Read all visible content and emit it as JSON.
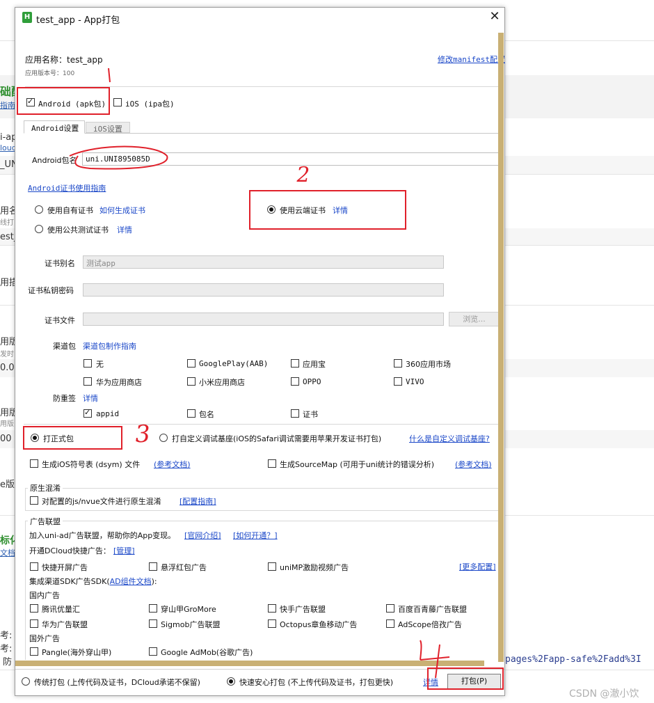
{
  "background": {
    "partial_texts": [
      "础配",
      "指南",
      "i-ap",
      "loud",
      "_UN",
      "用名",
      "线打",
      "est_",
      "用描",
      "用版",
      "发时",
      "0.0",
      "用版",
      "用版",
      "00",
      "e版",
      "标化",
      "文档",
      "考:",
      "考:",
      "防"
    ],
    "url_fragment": "pages%2Fapp-safe%2Fadd%3I"
  },
  "window": {
    "title": "test_app - App打包",
    "app_icon": "hbuilder-logo-icon",
    "close_icon": "close-icon"
  },
  "app_info": {
    "name_label": "应用名称：test_app",
    "version_label": "应用版本号：100",
    "modify_manifest_link": "修改manifest配置"
  },
  "platforms": [
    {
      "label": "Android (apk包)",
      "checked": true
    },
    {
      "label": "iOS (ipa包)",
      "checked": false
    }
  ],
  "tabs": [
    {
      "label": "Android设置",
      "active": true
    },
    {
      "label": "iOS设置",
      "active": false
    }
  ],
  "android": {
    "package_label": "Android包名",
    "package_value": "uni.UNI895085D",
    "cert_guide_link": "Android证书使用指南",
    "cert_own": "使用自有证书",
    "cert_own_link": "如何生成证书",
    "cert_public": "使用公共测试证书",
    "cert_public_link": "详情",
    "cert_cloud": "使用云端证书",
    "cert_cloud_link": "详情",
    "cert_alias_label": "证书别名",
    "cert_alias_value": "测试app",
    "cert_password_label": "证书私钥密码",
    "cert_file_label": "证书文件",
    "browse_button": "浏览...",
    "channel_label": "渠道包",
    "channel_link": "渠道包制作指南",
    "channels": [
      {
        "label": "无",
        "checked": false
      },
      {
        "label": "GooglePlay(AAB)",
        "checked": false
      },
      {
        "label": "应用宝",
        "checked": false
      },
      {
        "label": "360应用市场",
        "checked": false
      },
      {
        "label": "华为应用商店",
        "checked": false
      },
      {
        "label": "小米应用商店",
        "checked": false
      },
      {
        "label": "OPPO",
        "checked": false
      },
      {
        "label": "VIVO",
        "checked": false
      }
    ],
    "anti_repack_label": "防重签",
    "anti_repack_link": "详情",
    "anti_repack_options": [
      {
        "label": "appid",
        "checked": true
      },
      {
        "label": "包名",
        "checked": false
      },
      {
        "label": "证书",
        "checked": false
      }
    ]
  },
  "build_type": {
    "formal": "打正式包",
    "custom_base": "打自定义调试基座(iOS的Safari调试需要用苹果开发证书打包)",
    "custom_base_link": "什么是自定义调试基座?",
    "ios_dsym": "生成iOS符号表 (dsym) 文件",
    "ios_dsym_link": "(参考文档)",
    "sourcemap": "生成SourceMap (可用于uni统计的错误分析)",
    "sourcemap_link": "(参考文档)"
  },
  "obfuscation": {
    "title": "原生混淆",
    "option": "对配置的js/nvue文件进行原生混淆",
    "link": "[配置指南]"
  },
  "ads": {
    "title": "广告联盟",
    "intro": "加入uni-ad广告联盟，帮助你的App变现。",
    "intro_link1": "[官网介绍]",
    "intro_link2": "[如何开通？]",
    "dcloud_label": "开通DCloud快捷广告：",
    "dcloud_link": "[管理]",
    "quick_ads": [
      {
        "label": "快捷开屏广告"
      },
      {
        "label": "悬浮红包广告"
      },
      {
        "label": "uniMP激励视频广告"
      }
    ],
    "more_link": "[更多配置]",
    "sdk_label": "集成渠道SDK广告SDK(",
    "sdk_link": "AD组件文档",
    "sdk_label_end": "):",
    "domestic_title": "国内广告",
    "domestic": [
      {
        "label": "腾讯优量汇"
      },
      {
        "label": "穿山甲GroMore"
      },
      {
        "label": "快手广告联盟"
      },
      {
        "label": "百度百青藤广告联盟"
      },
      {
        "label": "华为广告联盟"
      },
      {
        "label": "Sigmob广告联盟"
      },
      {
        "label": "Octopus章鱼移动广告"
      },
      {
        "label": "AdScope倍孜广告"
      }
    ],
    "foreign_title": "国外广告",
    "foreign": [
      {
        "label": "Pangle(海外穿山甲)"
      },
      {
        "label": "Google AdMob(谷歌广告)"
      }
    ]
  },
  "footer": {
    "traditional": "传统打包 (上传代码及证书，DCloud承诺不保留)",
    "fast": "快速安心打包 (不上传代码及证书，打包更快)",
    "details_link": "详情",
    "pack_button": "打包(P)"
  },
  "annotations": {
    "numbers": [
      "2",
      "3"
    ],
    "watermark": "CSDN @澈小饮"
  },
  "colors": {
    "link": "#1a47c8",
    "annotation_red": "#e0202a",
    "scrollbar": "#c9b074"
  }
}
